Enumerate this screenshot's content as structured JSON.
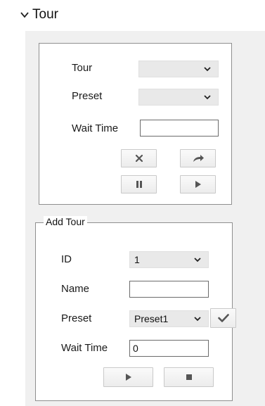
{
  "section": {
    "title": "Tour"
  },
  "tour_panel": {
    "tour_label": "Tour",
    "tour_value": "",
    "preset_label": "Preset",
    "preset_value": "",
    "wait_time_label": "Wait Time",
    "wait_time_value": ""
  },
  "add_tour": {
    "legend": "Add Tour",
    "id_label": "ID",
    "id_value": "1",
    "name_label": "Name",
    "name_value": "",
    "preset_label": "Preset",
    "preset_value": "Preset1",
    "wait_time_label": "Wait Time",
    "wait_time_value": "0"
  },
  "icons": {
    "collapse": "chevron-down-icon",
    "dropdown": "chevron-down-icon",
    "delete": "close-icon",
    "go": "arrow-right-icon",
    "pause": "pause-icon",
    "play": "play-icon",
    "confirm": "check-icon",
    "stop": "stop-icon"
  },
  "colors": {
    "panel_border": "#8f8f8f",
    "gutter": "#f0f0f0",
    "select_bg": "#e9e9e9",
    "icon": "#555555"
  }
}
